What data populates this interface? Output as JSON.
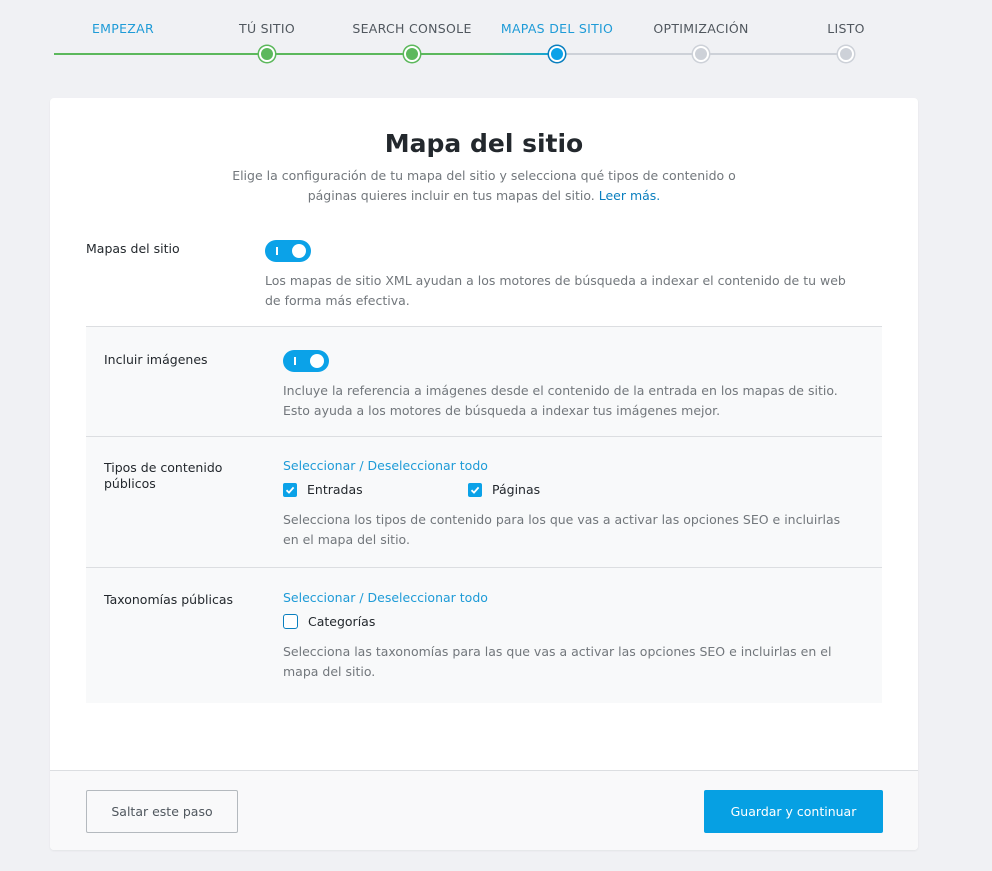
{
  "stepper": {
    "steps": [
      {
        "label": "EMPEZAR",
        "state": "done"
      },
      {
        "label": "TÚ SITIO",
        "state": "done"
      },
      {
        "label": "SEARCH CONSOLE",
        "state": "done"
      },
      {
        "label": "MAPAS DEL SITIO",
        "state": "current"
      },
      {
        "label": "OPTIMIZACIÓN",
        "state": "todo"
      },
      {
        "label": "LISTO",
        "state": "todo"
      }
    ]
  },
  "page": {
    "title": "Mapa del sitio",
    "subtitle": "Elige la configuración de tu mapa del sitio y selecciona qué tipos de contenido o páginas quieres incluir en tus mapas del sitio.",
    "read_more": "Leer más."
  },
  "sitemaps": {
    "label": "Mapas del sitio",
    "enabled": true,
    "description": "Los mapas de sitio XML ayudan a los motores de búsqueda a indexar el contenido de tu web de forma más efectiva."
  },
  "include_images": {
    "label": "Incluir imágenes",
    "enabled": true,
    "description": "Incluye la referencia a imágenes desde el contenido de la entrada en los mapas de sitio. Esto ayuda a los motores de búsqueda a indexar tus imágenes mejor."
  },
  "post_types": {
    "label": "Tipos de contenido públicos",
    "select_all": "Seleccionar / Deseleccionar todo",
    "options": [
      {
        "label": "Entradas",
        "checked": true
      },
      {
        "label": "Páginas",
        "checked": true
      }
    ],
    "description": "Selecciona los tipos de contenido para los que vas a activar las opciones SEO e incluirlas en el mapa del sitio."
  },
  "taxonomies": {
    "label": "Taxonomías públicas",
    "select_all": "Seleccionar / Deseleccionar todo",
    "options": [
      {
        "label": "Categorías",
        "checked": false
      }
    ],
    "description": "Selecciona las taxonomías para las que vas a activar las opciones SEO e incluirlas en el mapa del sitio."
  },
  "footer": {
    "skip_label": "Saltar este paso",
    "save_label": "Guardar y continuar"
  },
  "colors": {
    "accent": "#0ba2e8",
    "done": "#5cb85c",
    "todo": "#cdd1d8"
  }
}
